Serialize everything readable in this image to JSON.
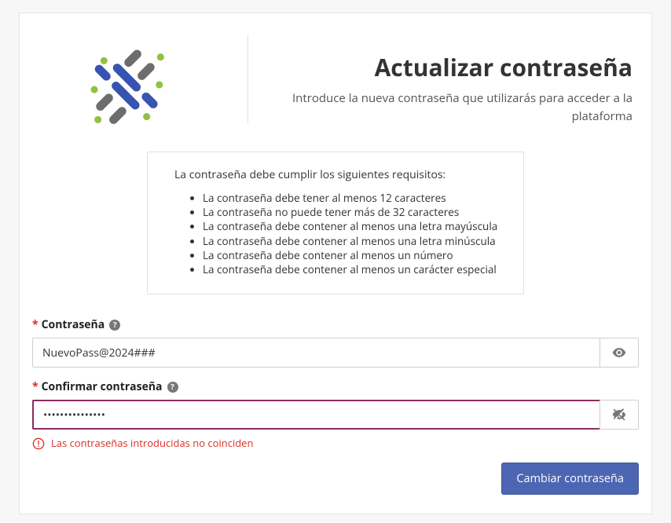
{
  "header": {
    "title": "Actualizar contraseña",
    "subtitle": "Introduce la nueva contraseña que utilizarás para acceder a la plataforma"
  },
  "requirements": {
    "heading": "La contraseña debe cumplir los siguientes requisitos:",
    "items": [
      "La contraseña debe tener al menos 12 caracteres",
      "La contraseña no puede tener más de 32 caracteres",
      "La contraseña debe contener al menos una letra mayúscula",
      "La contraseña debe contener al menos una letra minúscula",
      "La contraseña debe contener al menos un número",
      "La contraseña debe contener al menos un carácter especial"
    ]
  },
  "fields": {
    "password": {
      "label": "Contraseña",
      "value": "NuevoPass@2024###"
    },
    "confirm": {
      "label": "Confirmar contraseña",
      "value": "•••••••••••••••",
      "error": "Las contraseñas introducidas no coinciden"
    }
  },
  "actions": {
    "submit": "Cambiar contraseña"
  }
}
